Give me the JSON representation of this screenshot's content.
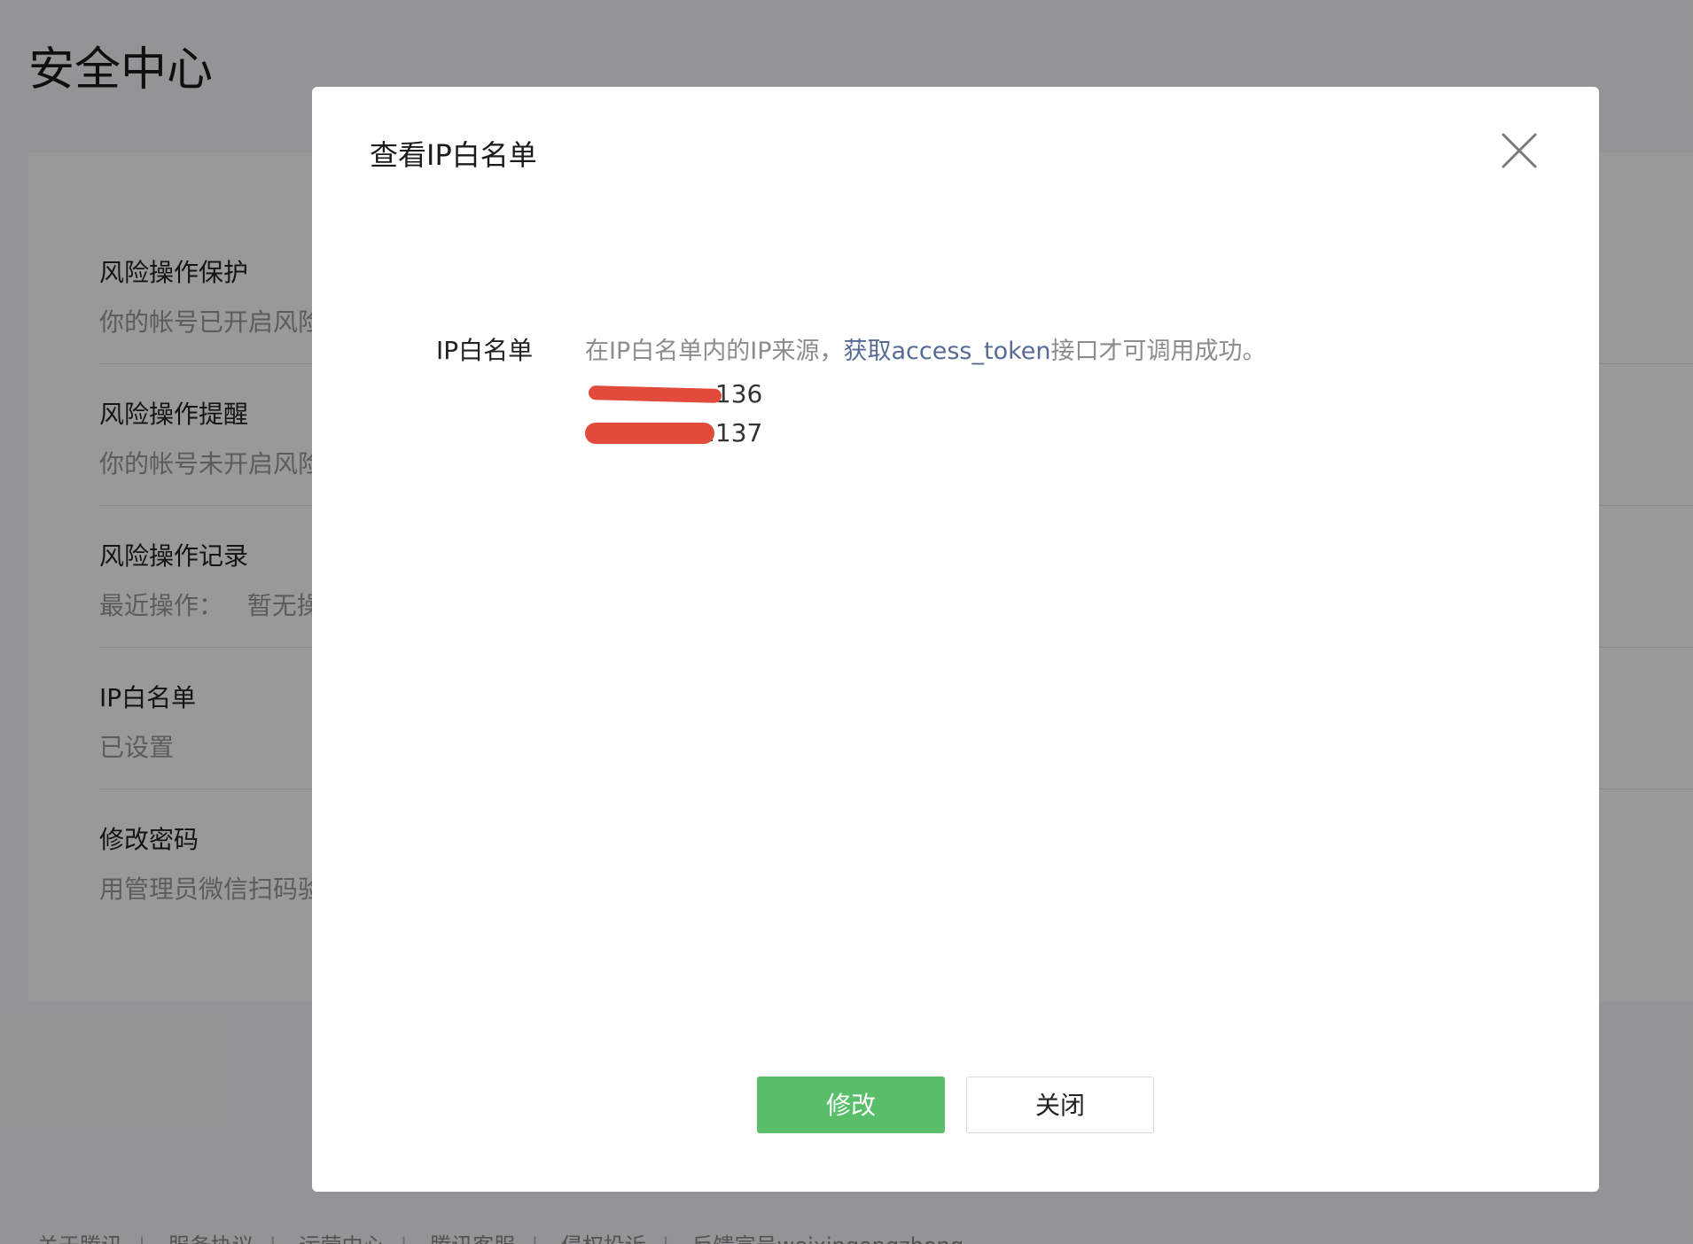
{
  "page": {
    "title": "安全中心"
  },
  "security_items": [
    {
      "title": "风险操作保护",
      "desc": "你的帐号已开启风险"
    },
    {
      "title": "风险操作提醒",
      "desc": "你的帐号未开启风险"
    },
    {
      "title": "风险操作记录",
      "desc": "最近操作：   暂无操"
    },
    {
      "title": "IP白名单",
      "desc": "已设置"
    },
    {
      "title": "修改密码",
      "desc": "用管理员微信扫码验"
    }
  ],
  "footer": {
    "links": [
      "关于腾讯",
      "服务协议",
      "运营中心",
      "腾讯客服",
      "侵权投诉",
      "反馈宣号weixingongzhong"
    ],
    "separator": "|"
  },
  "dialog": {
    "title": "查看IP白名单",
    "close_icon": "close-icon",
    "field_label": "IP白名单",
    "hint_prefix": "在IP白名单内的IP来源，",
    "hint_link": "获取access_token",
    "hint_suffix": "接口才可调用成功。",
    "ips": [
      ".136",
      ".137"
    ],
    "modify_label": "修改",
    "close_label": "关闭"
  },
  "colors": {
    "primary": "#58be6a",
    "link": "#576b95",
    "redaction": "#e24b3b",
    "mask": "rgba(0,0,0,0.4)"
  }
}
